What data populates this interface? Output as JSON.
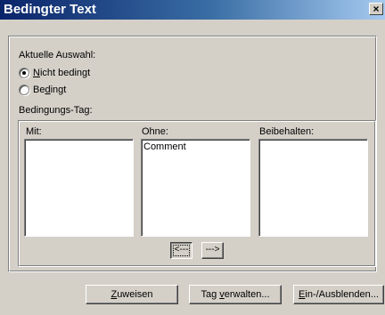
{
  "window": {
    "title": "Bedingter Text",
    "close_label": "×"
  },
  "current_selection": {
    "heading": "Aktuelle Auswahl:",
    "options": [
      {
        "label": "Nicht bedingt",
        "mnemonic": "N",
        "checked": true
      },
      {
        "label": "Bedingt",
        "mnemonic": "d",
        "checked": false
      }
    ]
  },
  "condition_tag": {
    "heading": "Bedingungs-Tag:",
    "lists": [
      {
        "label": "Mit:",
        "items": []
      },
      {
        "label": "Ohne:",
        "items": [
          "Comment"
        ]
      },
      {
        "label": "Beibehalten:",
        "items": []
      }
    ],
    "move_left_label": "<---",
    "move_right_label": "--->"
  },
  "buttons": {
    "apply": "Zuweisen",
    "manage_tags": "Tag verwalten...",
    "show_hide": "Ein-/Ausblenden..."
  }
}
